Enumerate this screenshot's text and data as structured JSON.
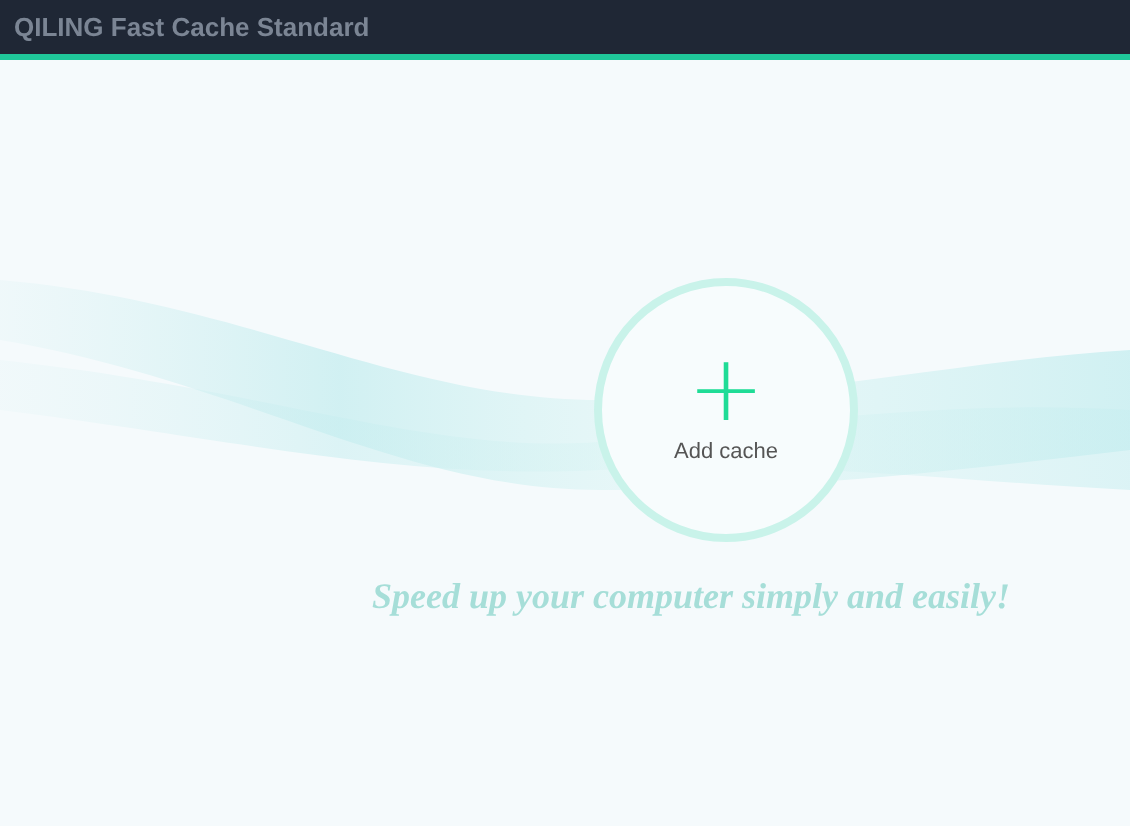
{
  "window": {
    "title": "QILING Fast Cache Standard"
  },
  "add_button": {
    "icon": "+",
    "label": "Add cache"
  },
  "slogan": "Speed up your computer simply and easily!"
}
